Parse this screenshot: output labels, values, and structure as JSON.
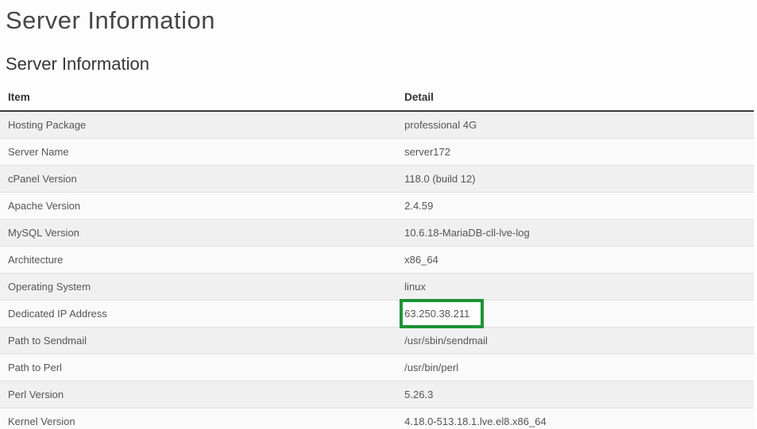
{
  "page": {
    "title": "Server Information"
  },
  "section": {
    "heading": "Server Information"
  },
  "table": {
    "columns": [
      {
        "key": "item",
        "label": "Item"
      },
      {
        "key": "detail",
        "label": "Detail"
      }
    ],
    "rows": [
      {
        "item": "Hosting Package",
        "detail": "professional 4G",
        "highlighted": false
      },
      {
        "item": "Server Name",
        "detail": "server172",
        "highlighted": false
      },
      {
        "item": "cPanel Version",
        "detail": "118.0 (build 12)",
        "highlighted": false
      },
      {
        "item": "Apache Version",
        "detail": "2.4.59",
        "highlighted": false
      },
      {
        "item": "MySQL Version",
        "detail": "10.6.18-MariaDB-cll-lve-log",
        "highlighted": false
      },
      {
        "item": "Architecture",
        "detail": "x86_64",
        "highlighted": false
      },
      {
        "item": "Operating System",
        "detail": "linux",
        "highlighted": false
      },
      {
        "item": "Dedicated IP Address",
        "detail": "63.250.38.211",
        "highlighted": true
      },
      {
        "item": "Path to Sendmail",
        "detail": "/usr/sbin/sendmail",
        "highlighted": false
      },
      {
        "item": "Path to Perl",
        "detail": "/usr/bin/perl",
        "highlighted": false
      },
      {
        "item": "Perl Version",
        "detail": "5.26.3",
        "highlighted": false
      },
      {
        "item": "Kernel Version",
        "detail": "4.18.0-513.18.1.lve.el8.x86_64",
        "highlighted": false
      }
    ]
  },
  "colors": {
    "highlight_border": "#1e9336",
    "stripe_odd": "#f0f0f0",
    "stripe_even": "#fafafa",
    "header_rule": "#3b3b3b"
  }
}
